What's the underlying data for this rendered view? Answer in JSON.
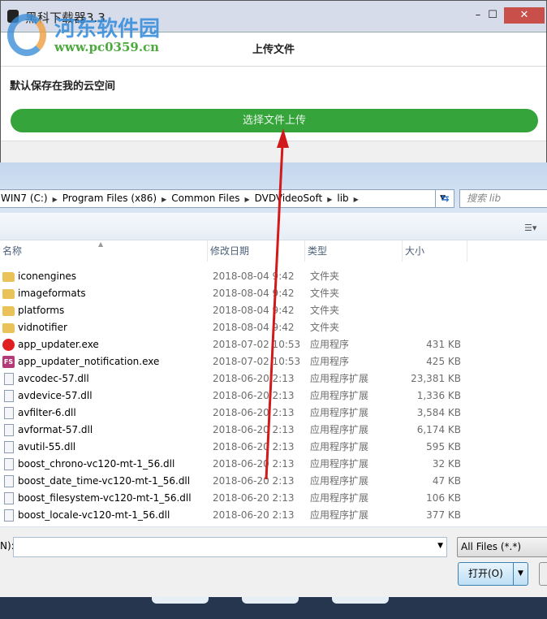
{
  "app": {
    "title": "黑科下载器3.3",
    "header": "上传文件",
    "description": "默认保存在我的云空间",
    "upload_button": "选择文件上传",
    "minimize": "–",
    "maximize": "☐",
    "close": "✕"
  },
  "watermark": {
    "name": "河东软件园",
    "url": "www.pc0359.cn"
  },
  "dialog": {
    "breadcrumb": [
      "WIN7 (C:)",
      "Program Files (x86)",
      "Common Files",
      "DVDVideoSoft",
      "lib"
    ],
    "search_placeholder": "搜索 lib",
    "columns": {
      "name": "名称",
      "date": "修改日期",
      "type": "类型",
      "size": "大小"
    },
    "files": [
      {
        "name": "iconengines",
        "date": "2018-08-04 9:42",
        "type": "文件夹",
        "size": "",
        "icon": "folder"
      },
      {
        "name": "imageformats",
        "date": "2018-08-04 9:42",
        "type": "文件夹",
        "size": "",
        "icon": "folder"
      },
      {
        "name": "platforms",
        "date": "2018-08-04 9:42",
        "type": "文件夹",
        "size": "",
        "icon": "folder"
      },
      {
        "name": "vidnotifier",
        "date": "2018-08-04 9:42",
        "type": "文件夹",
        "size": "",
        "icon": "folder"
      },
      {
        "name": "app_updater.exe",
        "date": "2018-07-02 10:53",
        "type": "应用程序",
        "size": "431 KB",
        "icon": "exe1"
      },
      {
        "name": "app_updater_notification.exe",
        "date": "2018-07-02 10:53",
        "type": "应用程序",
        "size": "425 KB",
        "icon": "exe2"
      },
      {
        "name": "avcodec-57.dll",
        "date": "2018-06-20 2:13",
        "type": "应用程序扩展",
        "size": "23,381 KB",
        "icon": "dll"
      },
      {
        "name": "avdevice-57.dll",
        "date": "2018-06-20 2:13",
        "type": "应用程序扩展",
        "size": "1,336 KB",
        "icon": "dll"
      },
      {
        "name": "avfilter-6.dll",
        "date": "2018-06-20 2:13",
        "type": "应用程序扩展",
        "size": "3,584 KB",
        "icon": "dll"
      },
      {
        "name": "avformat-57.dll",
        "date": "2018-06-20 2:13",
        "type": "应用程序扩展",
        "size": "6,174 KB",
        "icon": "dll"
      },
      {
        "name": "avutil-55.dll",
        "date": "2018-06-20 2:13",
        "type": "应用程序扩展",
        "size": "595 KB",
        "icon": "dll"
      },
      {
        "name": "boost_chrono-vc120-mt-1_56.dll",
        "date": "2018-06-20 2:13",
        "type": "应用程序扩展",
        "size": "32 KB",
        "icon": "dll"
      },
      {
        "name": "boost_date_time-vc120-mt-1_56.dll",
        "date": "2018-06-20 2:13",
        "type": "应用程序扩展",
        "size": "47 KB",
        "icon": "dll"
      },
      {
        "name": "boost_filesystem-vc120-mt-1_56.dll",
        "date": "2018-06-20 2:13",
        "type": "应用程序扩展",
        "size": "106 KB",
        "icon": "dll"
      },
      {
        "name": "boost_locale-vc120-mt-1_56.dll",
        "date": "2018-06-20 2:13",
        "type": "应用程序扩展",
        "size": "377 KB",
        "icon": "dll"
      }
    ],
    "filename_label": "N):",
    "filename_value": "",
    "filter": "All Files (*.*)",
    "open_button": "打开(O)"
  },
  "colors": {
    "accent_green": "#34a43b",
    "close_red": "#c9504a",
    "annotation_arrow": "#d21a1a"
  }
}
